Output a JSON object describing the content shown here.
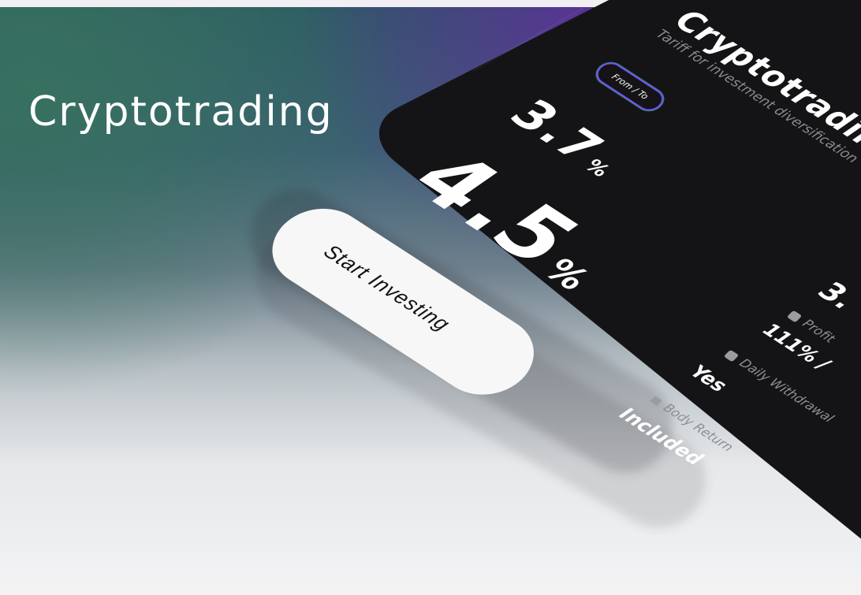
{
  "hero": {
    "title": "Cryptotrading"
  },
  "card": {
    "title": "Cryptotrading",
    "subtitle": "Tariff for investment diversification",
    "range_badge": "From / To",
    "rate_from": "3.7",
    "rate_to": "4.5",
    "percent_sign": "%",
    "start_button_label": "Start Investing",
    "partial_value": "3.",
    "stats": [
      {
        "icon": "calculator-icon",
        "label": "Profit",
        "value": "111% /"
      },
      {
        "icon": "wallet-icon",
        "label": "Daily Withdrawal",
        "value": "Yes"
      },
      {
        "icon": "arrow-return-icon",
        "label": "Body Return",
        "value": "Included"
      }
    ]
  },
  "colors": {
    "card_background": "#141416",
    "button_background": "#f7f7f7",
    "badge_border": "#7a4cff",
    "accent_purple": "#6a25a6",
    "accent_teal": "#37715f"
  }
}
